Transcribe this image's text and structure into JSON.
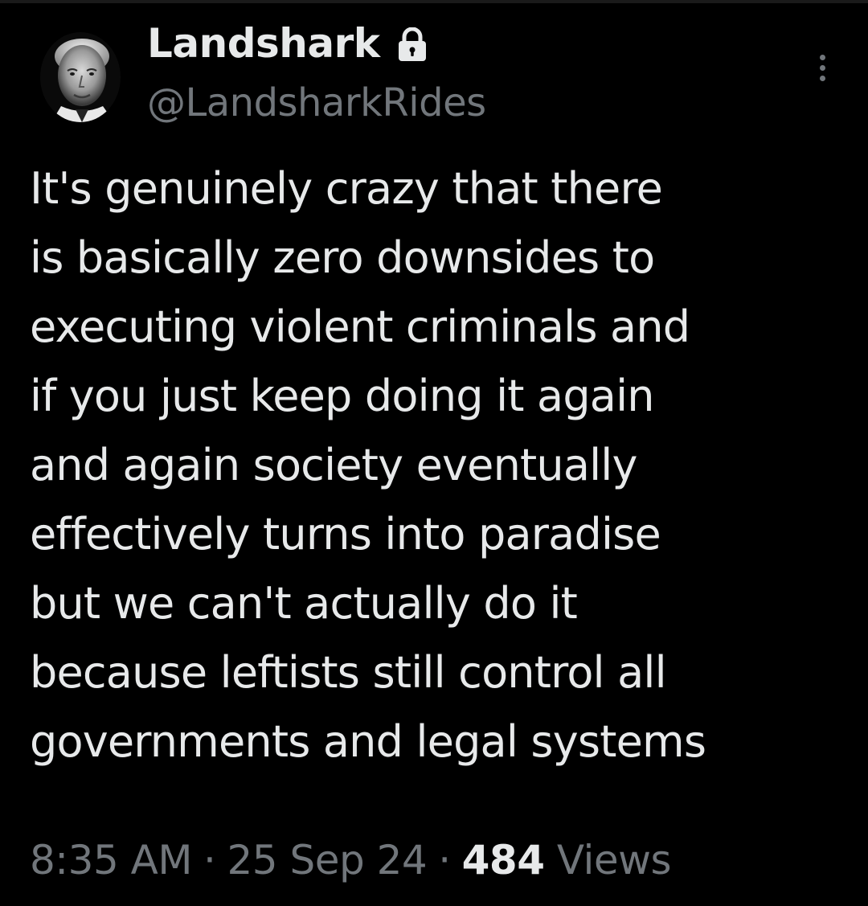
{
  "author": {
    "display_name": "Landshark",
    "handle": "@LandsharkRides",
    "protected_icon": "lock-icon",
    "avatar": "profile-photo"
  },
  "menu": {
    "icon": "more-vertical-icon"
  },
  "tweet": {
    "lines": [
      "It's genuinely crazy that there",
      "is basically zero downsides to",
      "executing violent criminals and",
      "if you just keep doing it again",
      "and again society eventually",
      "effectively turns into paradise",
      "but we can't actually do it",
      "because leftists still control all",
      "governments and legal systems"
    ]
  },
  "meta": {
    "time": "8:35 AM",
    "separator": "·",
    "date": "25 Sep 24",
    "views_count": "484",
    "views_label": "Views"
  },
  "colors": {
    "background": "#000000",
    "text_primary": "#e7e9ea",
    "text_secondary": "#71767b"
  }
}
